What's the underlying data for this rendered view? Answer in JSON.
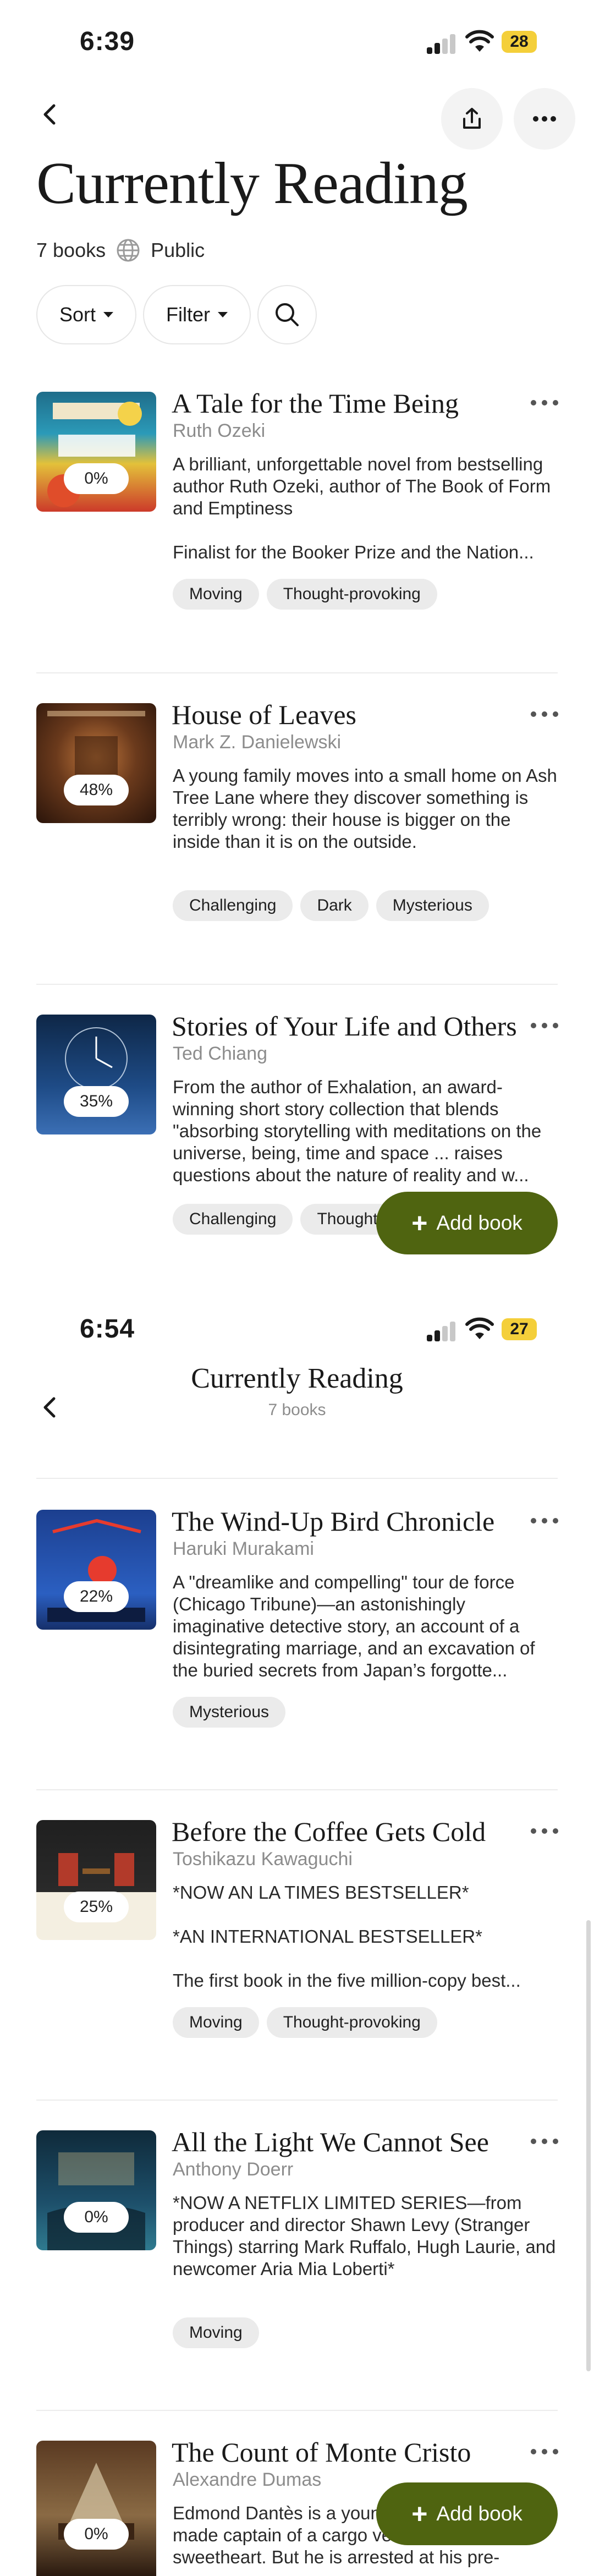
{
  "screen1": {
    "status": {
      "time": "6:39",
      "battery": "28"
    },
    "title": "Currently Reading",
    "book_count": "7 books",
    "visibility": "Public",
    "sort_label": "Sort",
    "filter_label": "Filter",
    "books": [
      {
        "title": "A Tale for the Time Being",
        "author": "Ruth Ozeki",
        "progress": "0%",
        "description": [
          "A brilliant, unforgettable novel from bestselling author Ruth Ozeki, author of The Book of Form and Emptiness",
          "Finalist for the Booker Prize and the Nation..."
        ],
        "tags": [
          "Moving",
          "Thought-provoking"
        ]
      },
      {
        "title": "House of Leaves",
        "author": "Mark Z. Danielewski",
        "progress": "48%",
        "description": [
          "A young family moves into a small home on Ash Tree Lane where they discover something is terribly wrong: their house is bigger on the inside than it is on the outside."
        ],
        "tags": [
          "Challenging",
          "Dark",
          "Mysterious"
        ]
      },
      {
        "title": "Stories of Your Life and Others",
        "author": "Ted Chiang",
        "progress": "35%",
        "description": [
          "From the author of Exhalation, an award-winning short story collection that blends \"absorbing storytelling with meditations on the universe, being, time and space ... raises questions about the nature of reality and w..."
        ],
        "tags": [
          "Challenging",
          "Thought-p"
        ]
      }
    ],
    "add_book_label": "Add book"
  },
  "screen2": {
    "status": {
      "time": "6:54",
      "battery": "27"
    },
    "header_title": "Currently Reading",
    "header_subtitle": "7 books",
    "books": [
      {
        "title": "The Wind-Up Bird Chronicle",
        "author": "Haruki Murakami",
        "progress": "22%",
        "description": [
          "A \"dreamlike and compelling\" tour de force (Chicago Tribune)—an astonishingly imaginative detective story, an account of a disintegrating marriage, and an excavation of the buried secrets from Japan’s forgotte..."
        ],
        "tags": [
          "Mysterious"
        ]
      },
      {
        "title": "Before the Coffee Gets Cold",
        "author": "Toshikazu Kawaguchi",
        "progress": "25%",
        "description": [
          "*NOW AN LA TIMES BESTSELLER*",
          "*AN INTERNATIONAL BESTSELLER*",
          "The first book in the five million-copy best..."
        ],
        "tags": [
          "Moving",
          "Thought-provoking"
        ]
      },
      {
        "title": "All the Light We Cannot See",
        "author": "Anthony Doerr",
        "progress": "0%",
        "description": [
          "*NOW A NETFLIX LIMITED SERIES—from producer and director Shawn Levy (Stranger Things) starring Mark Ruffalo, Hugh Laurie, and newcomer Aria Mia Loberti*"
        ],
        "tags": [
          "Moving"
        ]
      },
      {
        "title": "The Count of Monte Cristo",
        "author": "Alexandre Dumas",
        "progress": "0%",
        "description": [
          "Edmond Dantès is a young sailor who has been made captain of a cargo vessel and marry his sweetheart. But he is arrested at his pre-"
        ],
        "tags": []
      }
    ],
    "add_book_label": "Add book"
  },
  "colors": {
    "accent": "#4f6410",
    "battery": "#f4cf3a",
    "tag_bg": "#ebebeb",
    "muted_text": "#8c8c8c"
  },
  "icons": [
    "back-arrow-icon",
    "share-icon",
    "more-icon",
    "globe-icon",
    "search-icon",
    "plus-icon",
    "wifi-icon",
    "signal-icon"
  ]
}
